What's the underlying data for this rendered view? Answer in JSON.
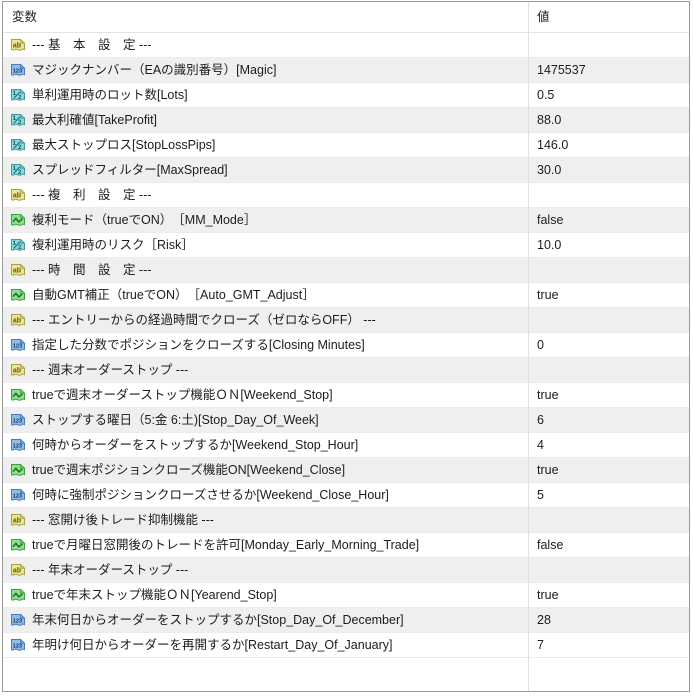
{
  "colors": {
    "stripe": "#efefef",
    "frame_border": "#9a9a9a",
    "column_divider": "#e0e0e0",
    "row_line": "#ececec",
    "text": "#1c1c1c",
    "icon_string": "#ede792",
    "icon_integer": "#8fbce8",
    "icon_double": "#8ed8db",
    "icon_boolean": "#90e092"
  },
  "table": {
    "columns": [
      {
        "label": "変数"
      },
      {
        "label": "値"
      }
    ],
    "rows": [
      {
        "icon": "string",
        "icon_name": "string-type-icon",
        "label": "--- 基　本　設　定 ---",
        "value": ""
      },
      {
        "icon": "integer",
        "icon_name": "integer-type-icon",
        "label": "マジックナンバー（EAの識別番号）[Magic]",
        "value": "1475537"
      },
      {
        "icon": "double",
        "icon_name": "double-type-icon",
        "label": "単利運用時のロット数[Lots]",
        "value": "0.5"
      },
      {
        "icon": "double",
        "icon_name": "double-type-icon",
        "label": "最大利確値[TakeProfit]",
        "value": "88.0"
      },
      {
        "icon": "double",
        "icon_name": "double-type-icon",
        "label": "最大ストップロス[StopLossPips]",
        "value": "146.0"
      },
      {
        "icon": "double",
        "icon_name": "double-type-icon",
        "label": "スプレッドフィルター[MaxSpread]",
        "value": "30.0"
      },
      {
        "icon": "string",
        "icon_name": "string-type-icon",
        "label": "--- 複　利　設　定 ---",
        "value": ""
      },
      {
        "icon": "boolean",
        "icon_name": "boolean-type-icon",
        "label": "複利モード（trueでON）　［MM_Mode］",
        "value": "false"
      },
      {
        "icon": "double",
        "icon_name": "double-type-icon",
        "label": "複利運用時のリスク［Risk］",
        "value": "10.0"
      },
      {
        "icon": "string",
        "icon_name": "string-type-icon",
        "label": "--- 時　間　設　定 ---",
        "value": ""
      },
      {
        "icon": "boolean",
        "icon_name": "boolean-type-icon",
        "label": "自動GMT補正（trueでON）　［Auto_GMT_Adjust］",
        "value": "true"
      },
      {
        "icon": "string",
        "icon_name": "string-type-icon",
        "label": "--- エントリーからの経過時間でクローズ（ゼロならOFF） ---",
        "value": ""
      },
      {
        "icon": "integer",
        "icon_name": "integer-type-icon",
        "label": "指定した分数でポジションをクローズする[Closing Minutes]",
        "value": "0"
      },
      {
        "icon": "string",
        "icon_name": "string-type-icon",
        "label": "--- 週末オーダーストップ ---",
        "value": ""
      },
      {
        "icon": "boolean",
        "icon_name": "boolean-type-icon",
        "label": "trueで週末オーダーストップ機能ＯＮ[Weekend_Stop]",
        "value": "true"
      },
      {
        "icon": "integer",
        "icon_name": "integer-type-icon",
        "label": "ストップする曜日（5:金 6:土)[Stop_Day_Of_Week]",
        "value": "6"
      },
      {
        "icon": "integer",
        "icon_name": "integer-type-icon",
        "label": "何時からオーダーをストップするか[Weekend_Stop_Hour]",
        "value": "4"
      },
      {
        "icon": "boolean",
        "icon_name": "boolean-type-icon",
        "label": "trueで週末ポジションクローズ機能ON[Weekend_Close]",
        "value": "true"
      },
      {
        "icon": "integer",
        "icon_name": "integer-type-icon",
        "label": "何時に強制ポジションクローズさせるか[Weekend_Close_Hour]",
        "value": "5"
      },
      {
        "icon": "string",
        "icon_name": "string-type-icon",
        "label": "--- 窓開け後トレード抑制機能 ---",
        "value": ""
      },
      {
        "icon": "boolean",
        "icon_name": "boolean-type-icon",
        "label": "trueで月曜日窓開後のトレードを許可[Monday_Early_Morning_Trade]",
        "value": "false"
      },
      {
        "icon": "string",
        "icon_name": "string-type-icon",
        "label": "--- 年末オーダーストップ ---",
        "value": ""
      },
      {
        "icon": "boolean",
        "icon_name": "boolean-type-icon",
        "label": "trueで年末ストップ機能ＯＮ[Yearend_Stop]",
        "value": "true"
      },
      {
        "icon": "integer",
        "icon_name": "integer-type-icon",
        "label": "年末何日からオーダーをストップするか[Stop_Day_Of_December]",
        "value": "28"
      },
      {
        "icon": "integer",
        "icon_name": "integer-type-icon",
        "label": "年明け何日からオーダーを再開するか[Restart_Day_Of_January]",
        "value": "7"
      }
    ]
  }
}
